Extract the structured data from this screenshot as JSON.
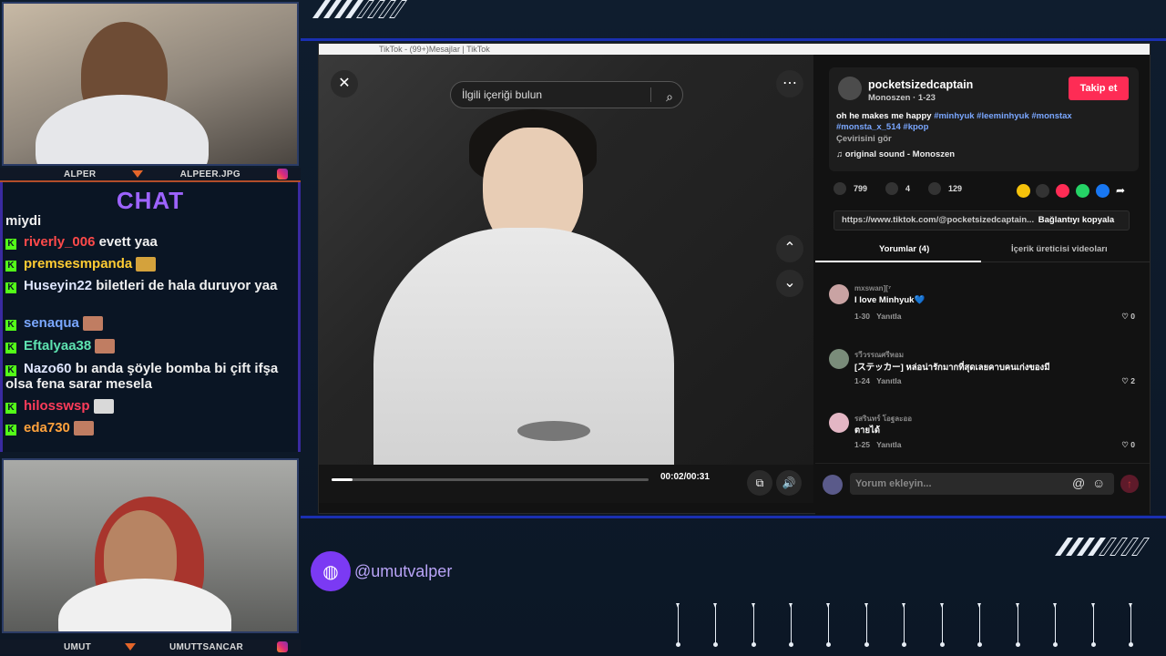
{
  "streamer_cams": {
    "cam1_left_label": "ALPER",
    "cam1_right_label": "ALPEER.JPG",
    "cam2_left_label": "UMUT",
    "cam2_right_label": "UMUTTSANCAR"
  },
  "chat": {
    "title": "CHAT",
    "messages": [
      {
        "user": "",
        "text": "miydi",
        "color": "#f0f0f0"
      },
      {
        "user": "riverly_006",
        "text": "evett yaa",
        "color": "#ff4a4a"
      },
      {
        "user": "premsesmpanda",
        "text": "",
        "color": "#ffcc33"
      },
      {
        "user": "Huseyin22",
        "text": "biletleri de hala duruyor yaa",
        "color": "#dfe6ff"
      },
      {
        "user": "senaqua",
        "text": "",
        "color": "#7aa7ff"
      },
      {
        "user": "Eftalyaa38",
        "text": "",
        "color": "#5ee3b0"
      },
      {
        "user": "Nazo60",
        "text": "bı anda şöyle bomba bi çift ifşa olsa fena sarar mesela",
        "color": "#dfe6ff"
      },
      {
        "user": "hilosswsp",
        "text": "",
        "color": "#ff3c5a"
      },
      {
        "user": "eda730",
        "text": "",
        "color": "#ffa23c"
      }
    ]
  },
  "browser": {
    "tab_title": "TikTok - (99+)Mesajlar | TikTok"
  },
  "video": {
    "search_placeholder": "İlgili içeriği bulun",
    "time": "00:02/00:31",
    "progress_fraction": 0.065
  },
  "post": {
    "username": "pocketsizedcaptain",
    "subtitle": "Monoszen · 1-23",
    "follow_label": "Takip et",
    "caption_text": "oh he makes me happy",
    "hashtags_line1": "#minhyuk #leeminhyuk #monstax",
    "hashtags_line2": "#monsta_x_514 #kpop",
    "see_translation": "Çevirisini gör",
    "sound": "original sound - Monoszen",
    "likes": "799",
    "comments": "4",
    "saves": "129",
    "link": "https://www.tiktok.com/@pocketsizedcaptain...",
    "copy_link": "Bağlantıyı kopyala",
    "tab_comments": "Yorumlar (4)",
    "tab_creator": "İçerik üreticisi videoları",
    "comment_placeholder": "Yorum ekleyin..."
  },
  "comments": [
    {
      "user": "mxswan][⁷",
      "text": "I love Minhyuk💙",
      "date": "1-30",
      "reply": "Yanıtla",
      "likes": "0"
    },
    {
      "user": "รวีวรรณศรีหอม",
      "text": "[ステッカー] หล่อน่ารักมากที่สุดเลยคาบคนเก่งของมี",
      "date": "1-24",
      "reply": "Yanıtla",
      "likes": "2"
    },
    {
      "user": "รสรินทร์ โอฐละออ",
      "text": "ตายได้",
      "date": "1-25",
      "reply": "Yanıtla",
      "likes": "0"
    }
  ],
  "overlay": {
    "handle": "@umutvalper"
  }
}
